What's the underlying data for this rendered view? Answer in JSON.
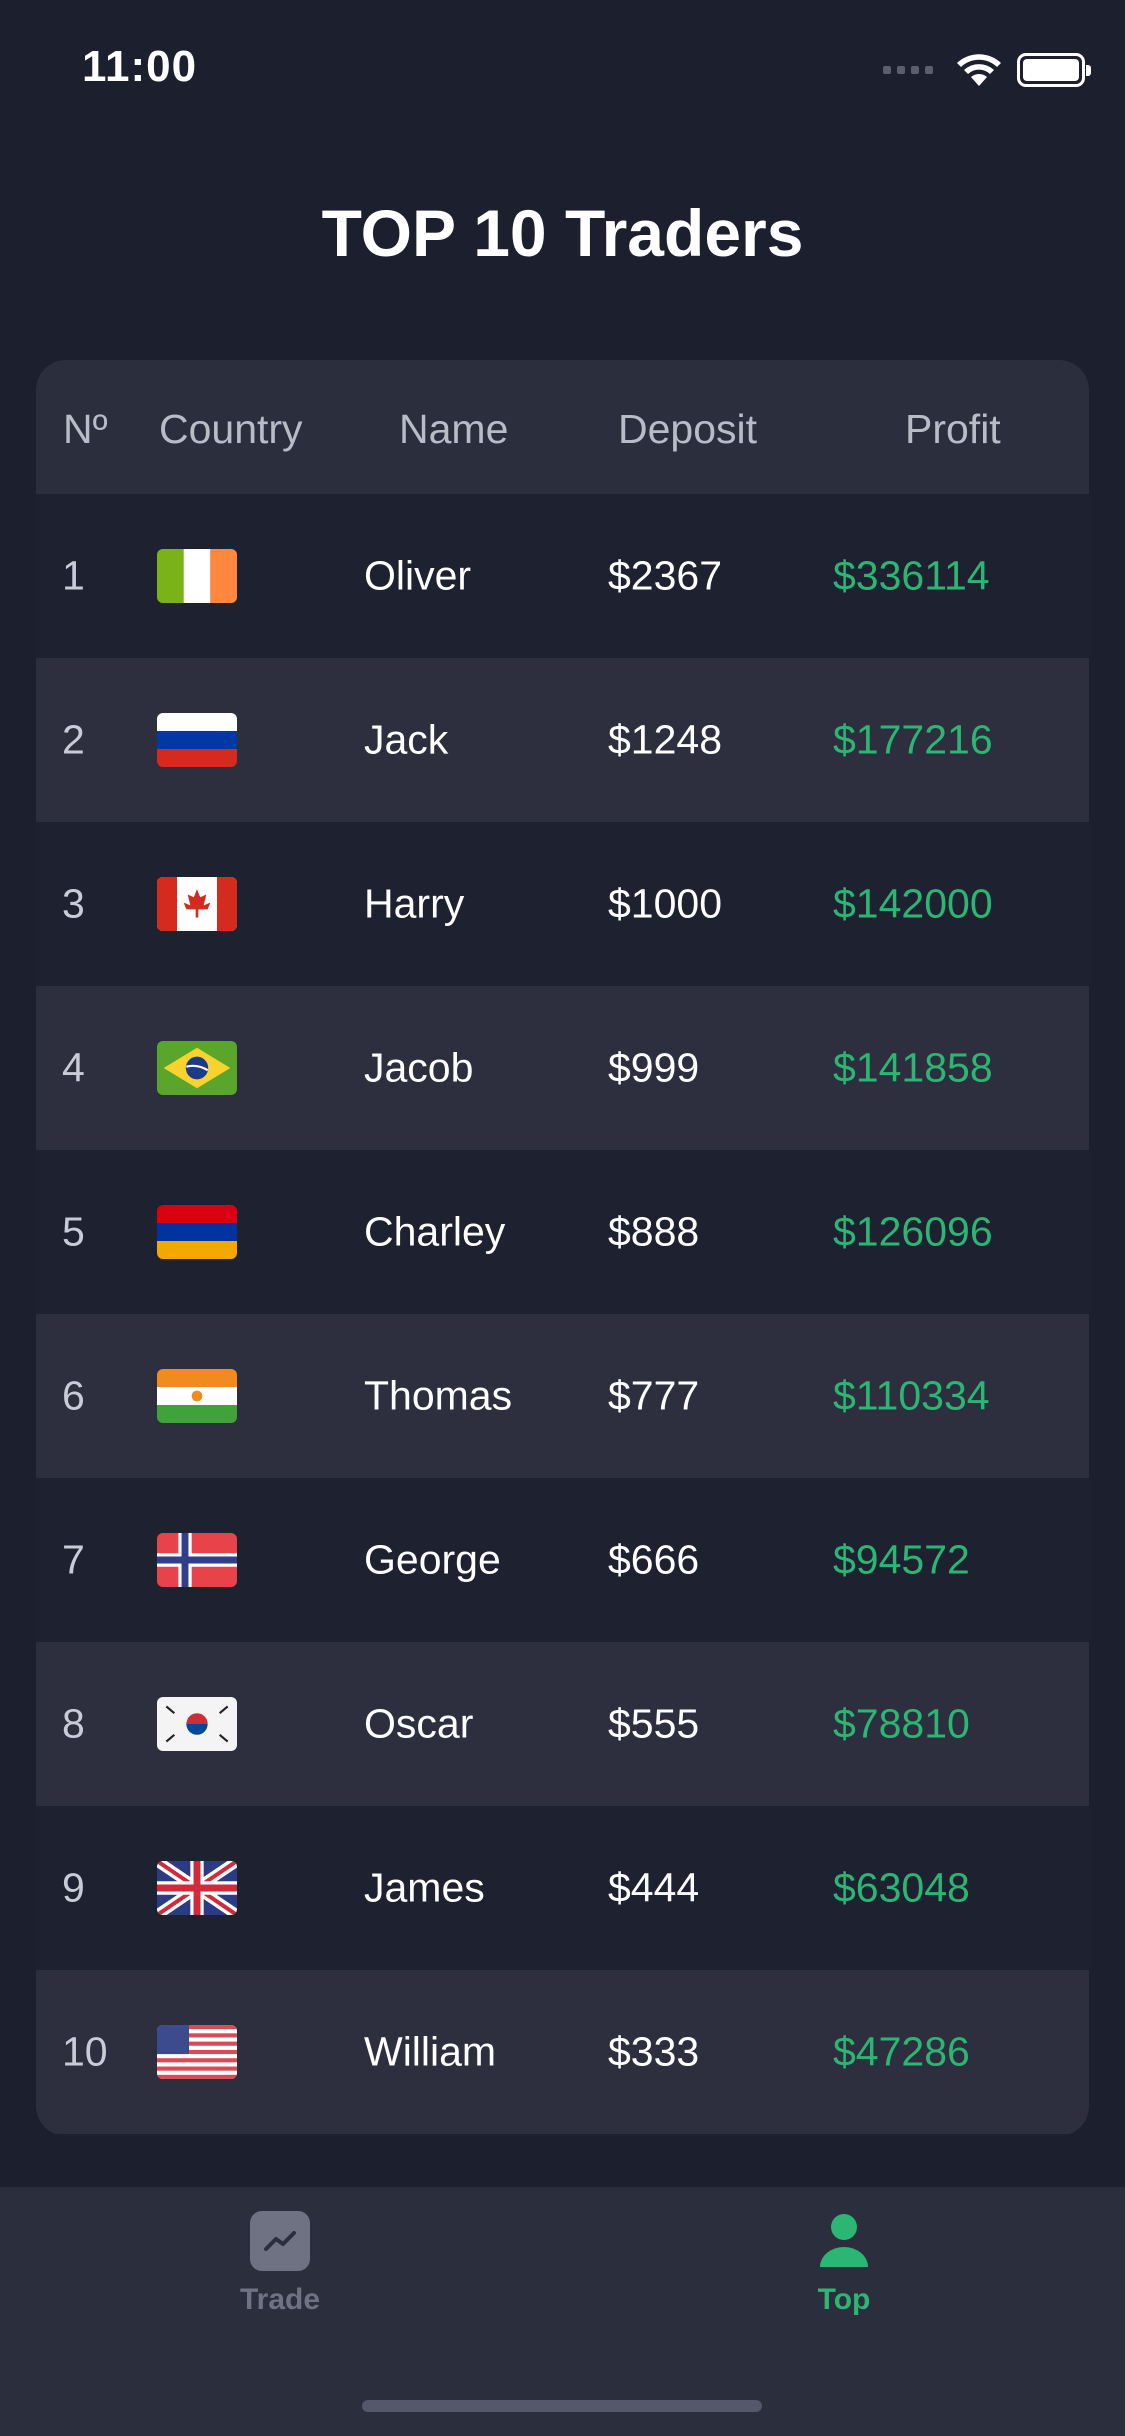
{
  "status": {
    "time": "11:00"
  },
  "title": "TOP 10 Traders",
  "table": {
    "headers": {
      "rank": "Nº",
      "country": "Country",
      "name": "Name",
      "deposit": "Deposit",
      "profit": "Profit"
    },
    "rows": [
      {
        "rank": "1",
        "flag": "ireland-flag",
        "name": "Oliver",
        "deposit": "$2367",
        "profit": "$336114"
      },
      {
        "rank": "2",
        "flag": "russia-flag",
        "name": "Jack",
        "deposit": "$1248",
        "profit": "$177216"
      },
      {
        "rank": "3",
        "flag": "canada-flag",
        "name": "Harry",
        "deposit": "$1000",
        "profit": "$142000"
      },
      {
        "rank": "4",
        "flag": "brazil-flag",
        "name": "Jacob",
        "deposit": "$999",
        "profit": "$141858"
      },
      {
        "rank": "5",
        "flag": "armenia-flag",
        "name": "Charley",
        "deposit": "$888",
        "profit": "$126096"
      },
      {
        "rank": "6",
        "flag": "niger-flag",
        "name": "Thomas",
        "deposit": "$777",
        "profit": "$110334"
      },
      {
        "rank": "7",
        "flag": "norway-flag",
        "name": "George",
        "deposit": "$666",
        "profit": "$94572"
      },
      {
        "rank": "8",
        "flag": "south-korea-flag",
        "name": "Oscar",
        "deposit": "$555",
        "profit": "$78810"
      },
      {
        "rank": "9",
        "flag": "uk-flag",
        "name": "James",
        "deposit": "$444",
        "profit": "$63048"
      },
      {
        "rank": "10",
        "flag": "usa-flag",
        "name": "William",
        "deposit": "$333",
        "profit": "$47286"
      }
    ]
  },
  "tabs": [
    {
      "label": "Trade",
      "icon": "chart-line-icon",
      "active": false
    },
    {
      "label": "Top",
      "icon": "person-icon",
      "active": true
    }
  ],
  "colors": {
    "background": "#1c1f2e",
    "profit": "#2bb673",
    "accent": "#2bb673"
  }
}
